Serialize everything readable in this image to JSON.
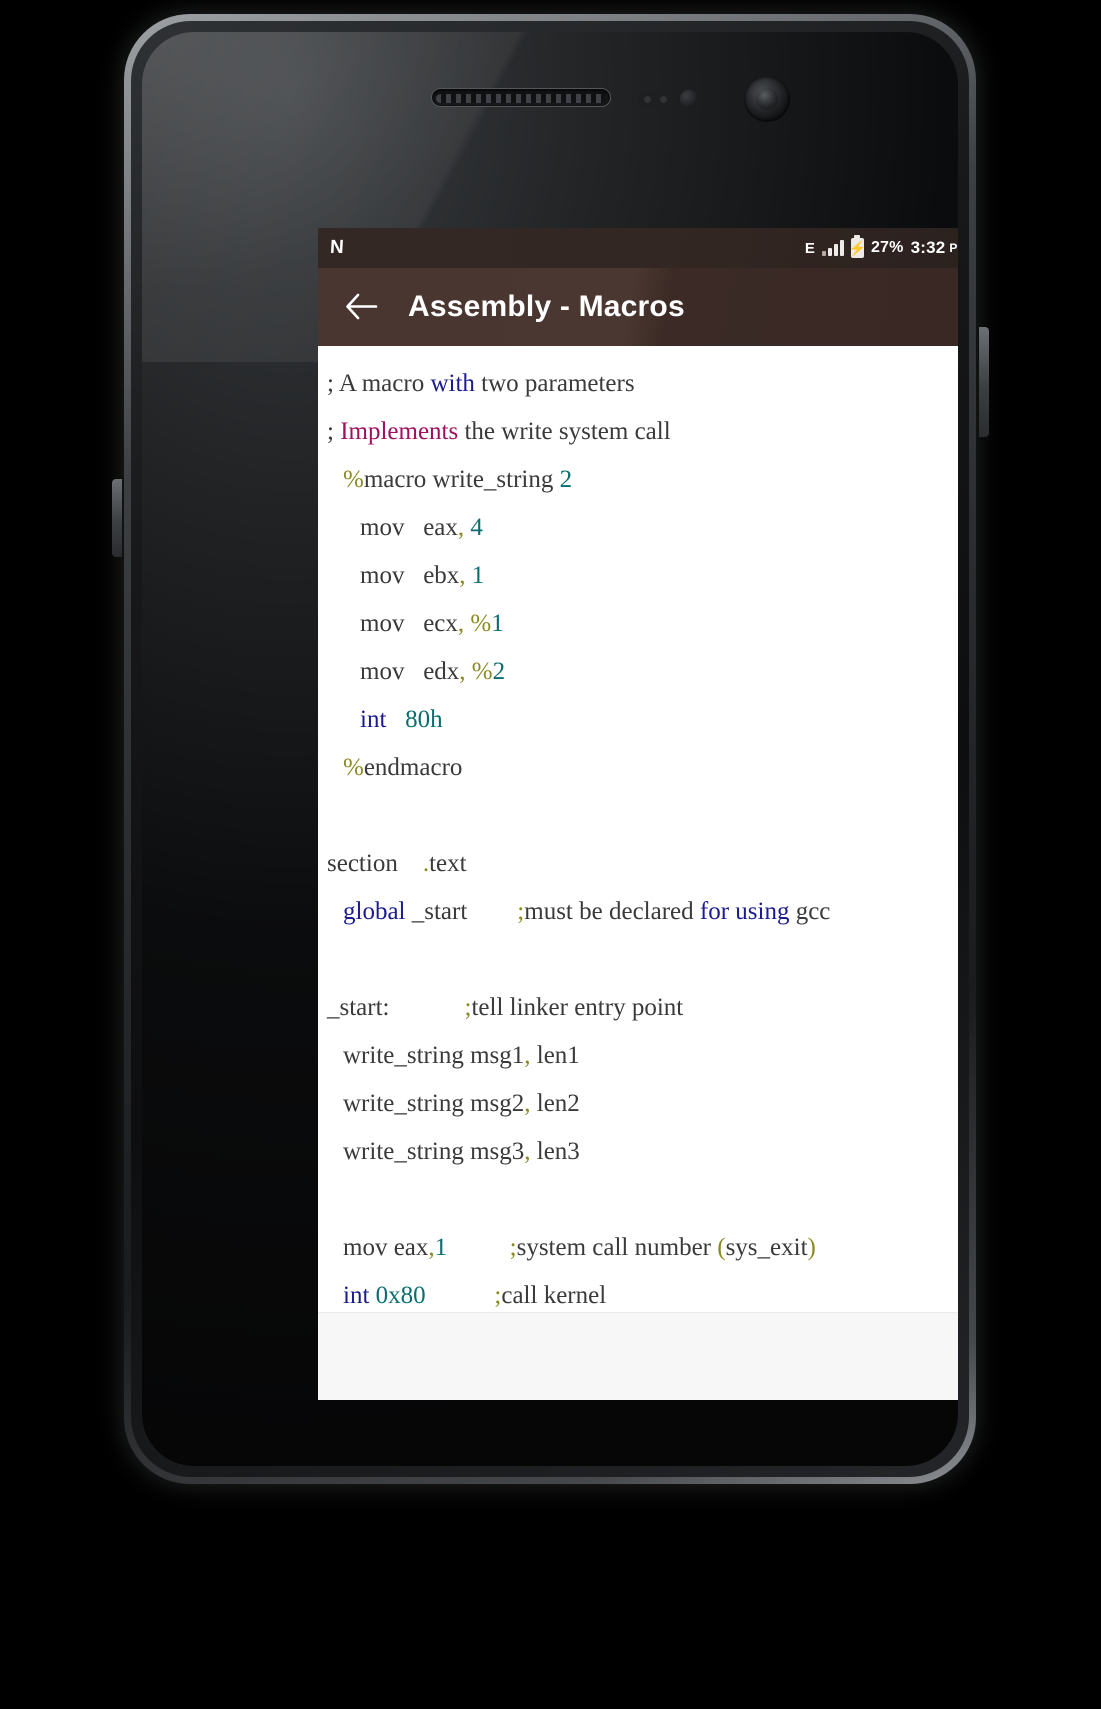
{
  "device": {
    "type": "android-phone-mockup"
  },
  "status_bar": {
    "logo": "N",
    "network_type": "E",
    "signal_icon": "signal-bars-icon",
    "battery_icon": "battery-charging-icon",
    "battery_percent": "27%",
    "time": "3:32",
    "ampm": "PM"
  },
  "app_bar": {
    "back_icon": "back-arrow-icon",
    "title": "Assembly - Macros"
  },
  "code": {
    "lines": [
      {
        "id": "l1",
        "indent": 0,
        "tokens": [
          {
            "t": "; A macro ",
            "c": "plain"
          },
          {
            "t": "with",
            "c": "key"
          },
          {
            "t": " two parameters",
            "c": "plain"
          }
        ]
      },
      {
        "id": "l2",
        "indent": 0,
        "tokens": [
          {
            "t": "; ",
            "c": "plain"
          },
          {
            "t": "Implements",
            "c": "mag"
          },
          {
            "t": " the write system call",
            "c": "plain"
          }
        ]
      },
      {
        "id": "l3",
        "indent": 1,
        "tokens": [
          {
            "t": "%",
            "c": "olive"
          },
          {
            "t": "macro write_string ",
            "c": "plain"
          },
          {
            "t": "2",
            "c": "num"
          }
        ]
      },
      {
        "id": "l4",
        "indent": 2,
        "tokens": [
          {
            "t": "mov   eax",
            "c": "plain"
          },
          {
            "t": ",",
            "c": "olive"
          },
          {
            "t": " ",
            "c": "plain"
          },
          {
            "t": "4",
            "c": "num"
          }
        ]
      },
      {
        "id": "l5",
        "indent": 2,
        "tokens": [
          {
            "t": "mov   ebx",
            "c": "plain"
          },
          {
            "t": ",",
            "c": "olive"
          },
          {
            "t": " ",
            "c": "plain"
          },
          {
            "t": "1",
            "c": "num"
          }
        ]
      },
      {
        "id": "l6",
        "indent": 2,
        "tokens": [
          {
            "t": "mov   ecx",
            "c": "plain"
          },
          {
            "t": ",",
            "c": "olive"
          },
          {
            "t": " ",
            "c": "plain"
          },
          {
            "t": "%",
            "c": "olive"
          },
          {
            "t": "1",
            "c": "num"
          }
        ]
      },
      {
        "id": "l7",
        "indent": 2,
        "tokens": [
          {
            "t": "mov   edx",
            "c": "plain"
          },
          {
            "t": ",",
            "c": "olive"
          },
          {
            "t": " ",
            "c": "plain"
          },
          {
            "t": "%",
            "c": "olive"
          },
          {
            "t": "2",
            "c": "num"
          }
        ]
      },
      {
        "id": "l8",
        "indent": 2,
        "tokens": [
          {
            "t": "int",
            "c": "key"
          },
          {
            "t": "   ",
            "c": "plain"
          },
          {
            "t": "80h",
            "c": "num"
          }
        ]
      },
      {
        "id": "l9",
        "indent": 1,
        "tokens": [
          {
            "t": "%",
            "c": "olive"
          },
          {
            "t": "endmacro",
            "c": "plain"
          }
        ]
      },
      {
        "id": "l10",
        "indent": 0,
        "tokens": []
      },
      {
        "id": "l11",
        "indent": 0,
        "tokens": [
          {
            "t": "section    ",
            "c": "plain"
          },
          {
            "t": ".",
            "c": "olive"
          },
          {
            "t": "text",
            "c": "plain"
          }
        ]
      },
      {
        "id": "l12",
        "indent": 1,
        "tokens": [
          {
            "t": "global",
            "c": "key"
          },
          {
            "t": " _start        ",
            "c": "plain"
          },
          {
            "t": ";",
            "c": "olive"
          },
          {
            "t": "must be declared ",
            "c": "plain"
          },
          {
            "t": "for using",
            "c": "key"
          },
          {
            "t": " gcc",
            "c": "plain"
          }
        ]
      },
      {
        "id": "l13",
        "indent": 0,
        "tokens": []
      },
      {
        "id": "l14",
        "indent": 0,
        "tokens": [
          {
            "t": "_start:            ",
            "c": "plain"
          },
          {
            "t": ";",
            "c": "olive"
          },
          {
            "t": "tell linker entry point",
            "c": "plain"
          }
        ]
      },
      {
        "id": "l15",
        "indent": 1,
        "tokens": [
          {
            "t": "write_string msg1",
            "c": "plain"
          },
          {
            "t": ",",
            "c": "olive"
          },
          {
            "t": " len1",
            "c": "plain"
          }
        ]
      },
      {
        "id": "l16",
        "indent": 1,
        "tokens": [
          {
            "t": "write_string msg2",
            "c": "plain"
          },
          {
            "t": ",",
            "c": "olive"
          },
          {
            "t": " len2",
            "c": "plain"
          }
        ]
      },
      {
        "id": "l17",
        "indent": 1,
        "tokens": [
          {
            "t": "write_string msg3",
            "c": "plain"
          },
          {
            "t": ",",
            "c": "olive"
          },
          {
            "t": " len3",
            "c": "plain"
          }
        ]
      },
      {
        "id": "l18",
        "indent": 0,
        "tokens": []
      },
      {
        "id": "l19",
        "indent": 1,
        "tokens": [
          {
            "t": "mov eax",
            "c": "plain"
          },
          {
            "t": ",",
            "c": "olive"
          },
          {
            "t": "1",
            "c": "num"
          },
          {
            "t": "          ",
            "c": "plain"
          },
          {
            "t": ";",
            "c": "olive"
          },
          {
            "t": "system call number ",
            "c": "plain"
          },
          {
            "t": "(",
            "c": "olive"
          },
          {
            "t": "sys_exit",
            "c": "plain"
          },
          {
            "t": ")",
            "c": "olive"
          }
        ]
      },
      {
        "id": "l20",
        "indent": 1,
        "tokens": [
          {
            "t": "int",
            "c": "key"
          },
          {
            "t": " ",
            "c": "plain"
          },
          {
            "t": "0x80",
            "c": "num"
          },
          {
            "t": "           ",
            "c": "plain"
          },
          {
            "t": ";",
            "c": "olive"
          },
          {
            "t": "call kernel",
            "c": "plain"
          }
        ]
      }
    ]
  },
  "colors": {
    "status_bar_bg": "#332824",
    "app_bar_bg": "#4a3630",
    "keyword": "#1b1b8f",
    "magenta": "#9e1060",
    "number": "#0b6e6e",
    "punctuation": "#8a8a22",
    "text": "#3a3a3a",
    "page_bg": "#ffffff"
  }
}
